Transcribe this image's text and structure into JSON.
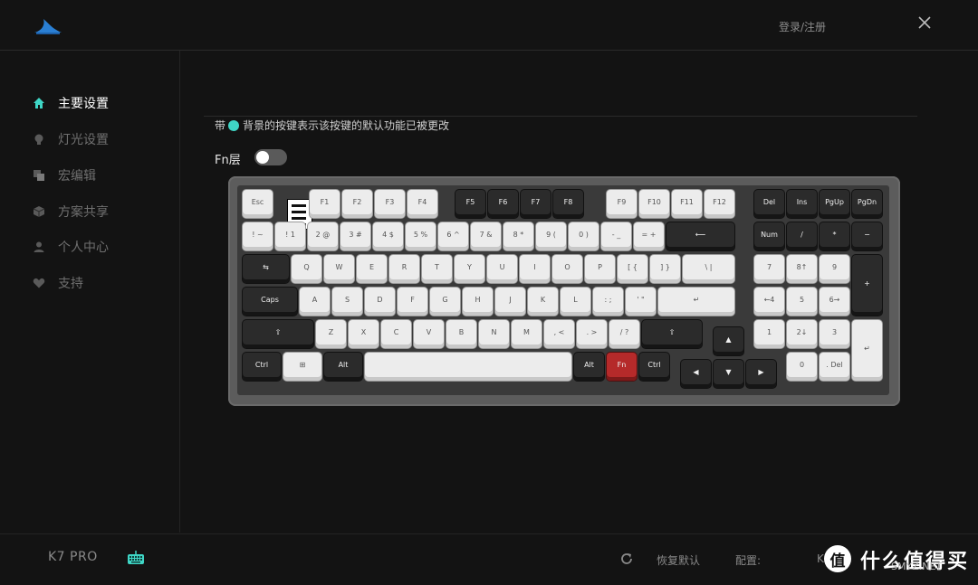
{
  "header": {
    "login_label": "登录/注册",
    "logo_icon": "shark-fin-logo-icon",
    "close_icon": "close-icon"
  },
  "colors": {
    "accent": "#3fd6c6",
    "background": "#131313",
    "fn_key": "#b52a2a"
  },
  "sidebar": {
    "items": [
      {
        "label": "主要设置",
        "icon": "home-icon",
        "active": true
      },
      {
        "label": "灯光设置",
        "icon": "lightbulb-icon",
        "active": false
      },
      {
        "label": "宏编辑",
        "icon": "macro-icon",
        "active": false
      },
      {
        "label": "方案共享",
        "icon": "cube-icon",
        "active": false
      },
      {
        "label": "个人中心",
        "icon": "user-icon",
        "active": false
      },
      {
        "label": "支持",
        "icon": "heart-icon",
        "active": false
      }
    ]
  },
  "main": {
    "hint_prefix": "带",
    "hint_suffix": "背景的按键表示该按键的默认功能已被更改",
    "fn_layer_label": "Fn层",
    "fn_layer_enabled": false
  },
  "keyboard": {
    "keys": {
      "esc": "Esc",
      "f1": "F1",
      "f2": "F2",
      "f3": "F3",
      "f4": "F4",
      "f5": "F5",
      "f6": "F6",
      "f7": "F7",
      "f8": "F8",
      "f9": "F9",
      "f10": "F10",
      "f11": "F11",
      "f12": "F12",
      "del": "Del",
      "ins": "Ins",
      "pgup": "PgUp",
      "pgdn": "PgDn",
      "tilde": "! ~",
      "n1": "! 1",
      "n2": "2 @",
      "n3": "3 #",
      "n4": "4 $",
      "n5": "5 %",
      "n6": "6 ^",
      "n7": "7 &",
      "n8": "8 *",
      "n9": "9 (",
      "n0": "0 )",
      "minus": "- _",
      "equal": "= +",
      "backspace": "⟵",
      "num": "Num",
      "slash": "/",
      "asterisk": "*",
      "dash": "−",
      "tab": "⇆",
      "q": "Q",
      "w": "W",
      "e": "E",
      "r": "R",
      "t": "T",
      "y": "Y",
      "u": "U",
      "i": "I",
      "o": "O",
      "p": "P",
      "lbracket": "[ {",
      "rbracket": "] }",
      "backslash": "\\ |",
      "num7": "7",
      "num8": "8↑",
      "num9": "9",
      "plus": "+",
      "caps": "Caps",
      "a": "A",
      "s": "S",
      "d": "D",
      "f": "F",
      "g": "G",
      "h": "H",
      "j": "J",
      "k": "K",
      "l": "L",
      "semicolon": ": ;",
      "quote": "' \"",
      "enter": "↵",
      "num4": "←4",
      "num5": "5",
      "num6": "6→",
      "lshift": "⇧",
      "z": "Z",
      "x": "X",
      "c": "C",
      "v": "V",
      "b": "B",
      "n": "N",
      "m": "M",
      "comma": ", <",
      "period": ". >",
      "question": "/ ?",
      "rshift": "⇧",
      "up": "▲",
      "num1": "1",
      "num2": "2↓",
      "num3": "3",
      "numenter": "↵",
      "ctrl": "Ctrl",
      "win": "⊞",
      "alt": "Alt",
      "space": "",
      "ralt": "Alt",
      "fn": "Fn",
      "rctrl": "Ctrl",
      "left": "◀",
      "down": "▼",
      "right": "▶",
      "num0": "0",
      "numdot": ". Del"
    }
  },
  "footer": {
    "model": "K7 PRO",
    "keyboard_icon": "keyboard-icon",
    "restore_label": "恢复默认",
    "config_label": "配置:",
    "config_value": "K7",
    "refresh_icon": "refresh-icon"
  },
  "watermark": {
    "badge": "值",
    "text": "什么值得买",
    "url": "SMYZ.NET"
  }
}
